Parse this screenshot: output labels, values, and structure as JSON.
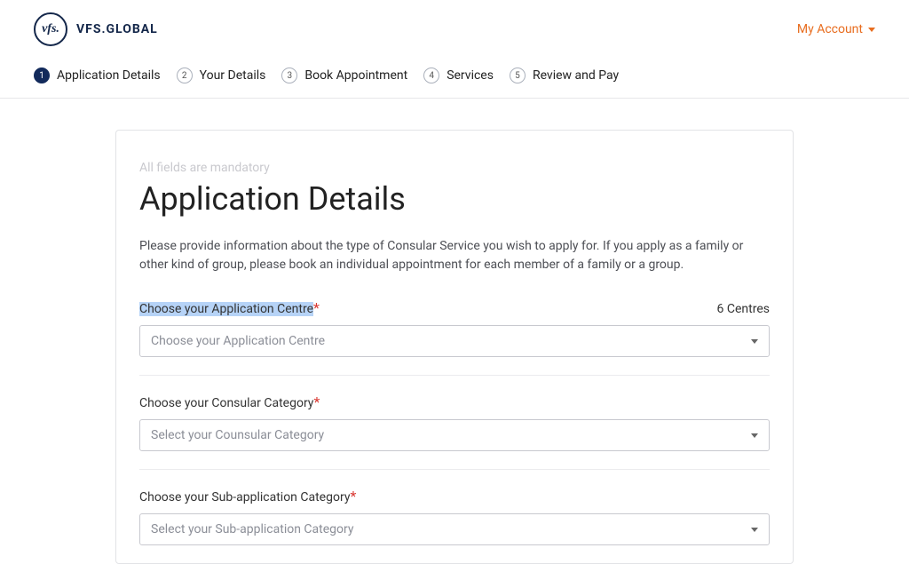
{
  "header": {
    "logo_mark": "vfs.",
    "logo_text": "VFS.GLOBAL",
    "account_label": "My Account"
  },
  "stepper": {
    "steps": [
      {
        "num": "1",
        "label": "Application Details"
      },
      {
        "num": "2",
        "label": "Your Details"
      },
      {
        "num": "3",
        "label": "Book Appointment"
      },
      {
        "num": "4",
        "label": "Services"
      },
      {
        "num": "5",
        "label": "Review and Pay"
      }
    ]
  },
  "form": {
    "mandatory_note": "All fields are mandatory",
    "title": "Application Details",
    "intro": "Please provide information about the type of Consular Service you wish to apply for. If you apply as a family or other kind of group, please book an individual appointment for each member of a family or a group.",
    "fields": {
      "app_centre": {
        "label": "Choose your Application Centre",
        "count": "6 Centres",
        "placeholder": "Choose your Application Centre"
      },
      "consular_category": {
        "label": "Choose your Consular Category",
        "placeholder": "Select your Counsular Category"
      },
      "sub_category": {
        "label": "Choose your Sub-application Category",
        "placeholder": "Select your Sub-application Category"
      }
    }
  }
}
